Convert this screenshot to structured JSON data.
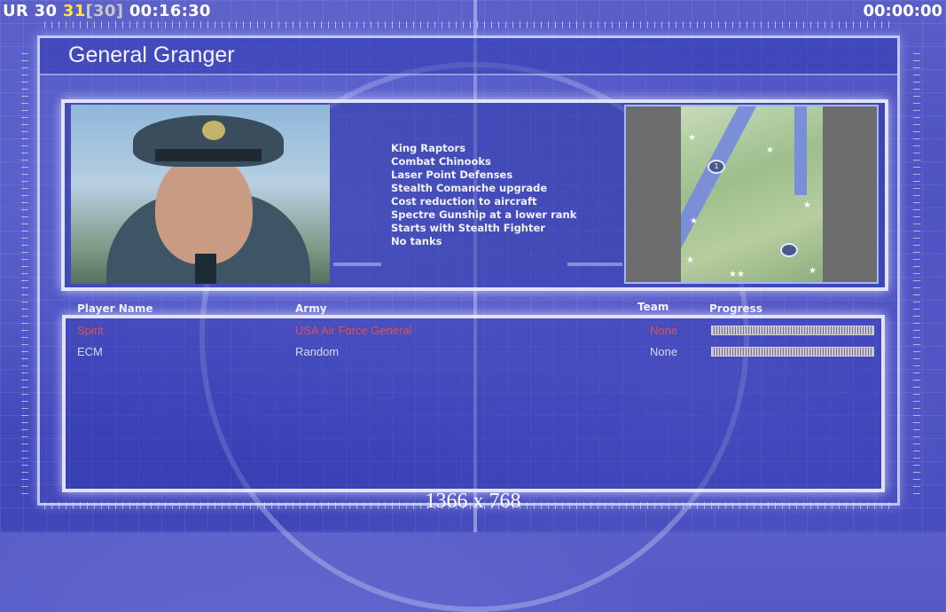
{
  "overlay": {
    "prefix": "UR 30",
    "highlight": "31",
    "bracket_value": "[30]",
    "elapsed": "00:16:30",
    "timer": "00:00:00"
  },
  "general": {
    "name": "General Granger",
    "features": [
      "King Raptors",
      "Combat Chinooks",
      "Laser Point Defenses",
      "Stealth Comanche upgrade",
      "Cost reduction to aircraft",
      "Spectre Gunship at a lower rank",
      "Starts with Stealth Fighter",
      "No tanks"
    ]
  },
  "map": {
    "start_position_1": "1"
  },
  "players": {
    "headers": {
      "name": "Player Name",
      "army": "Army",
      "team": "Team",
      "progress": "Progress"
    },
    "rows": [
      {
        "name": "Spirit",
        "army": "USA Air Force General",
        "team": "None",
        "progress": 1.0
      },
      {
        "name": "ECM",
        "army": "Random",
        "team": "None",
        "progress": 1.0
      }
    ]
  },
  "resolution_label": "1366 x 768",
  "colors": {
    "background": "#4a4fc0",
    "human_player": "#e05050",
    "overlay_yellow": "#ffe34a"
  }
}
